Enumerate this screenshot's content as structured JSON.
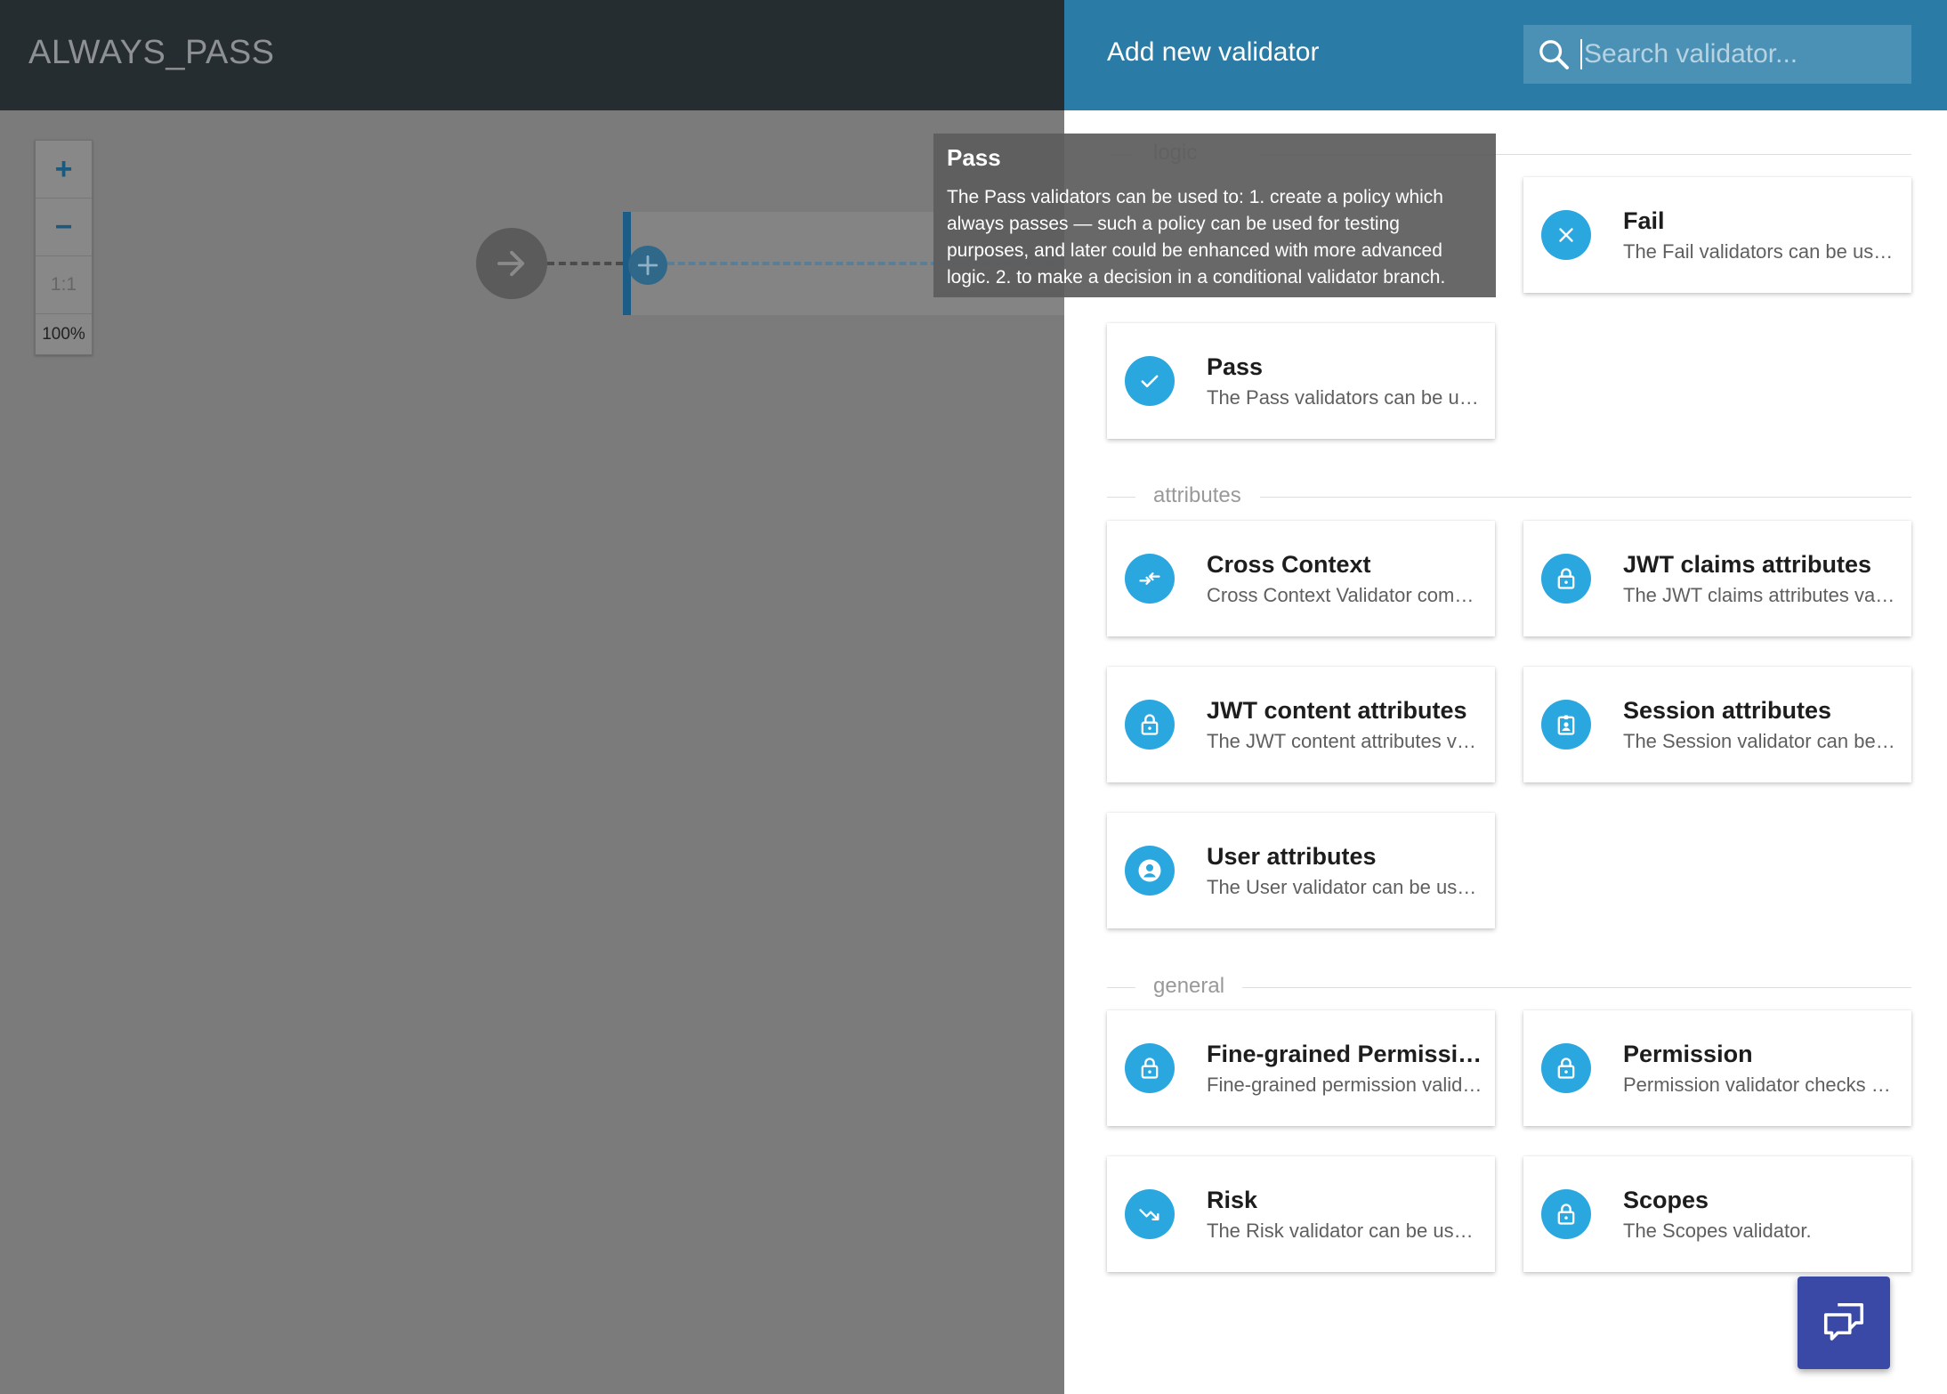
{
  "editor": {
    "title": "ALWAYS_PASS",
    "zoom": {
      "in_label": "+",
      "out_label": "−",
      "reset_label": "1:1",
      "level": "100%"
    }
  },
  "panel": {
    "title": "Add new validator",
    "search": {
      "placeholder": "Search validator...",
      "value": ""
    },
    "sections": {
      "logic": "logic",
      "attributes": "attributes",
      "general": "general"
    },
    "cards": {
      "fail": {
        "title": "Fail",
        "desc": "The Fail validators can be used to make a decision in a conditional validator branch.",
        "icon": "close-icon"
      },
      "pass": {
        "title": "Pass",
        "desc": "The Pass validators can be used to create a policy which always passes.",
        "icon": "check-icon"
      },
      "cross_context": {
        "title": "Cross Context",
        "desc": "Cross Context Validator compares values from different contexts.",
        "icon": "compare-arrows-icon"
      },
      "jwt_claims": {
        "title": "JWT claims attributes",
        "desc": "The JWT claims attributes validator can be used to check claims.",
        "icon": "lock-icon"
      },
      "jwt_content": {
        "title": "JWT content attributes",
        "desc": "The JWT content attributes validator can be used to check content.",
        "icon": "lock-icon"
      },
      "session": {
        "title": "Session attributes",
        "desc": "The Session validator can be used to check session attributes.",
        "icon": "badge-icon"
      },
      "user": {
        "title": "User attributes",
        "desc": "The User validator can be used to check user attributes.",
        "icon": "user-circle-icon"
      },
      "fine_grained": {
        "title": "Fine-grained Permission",
        "desc": "Fine-grained permission validator checks permissions.",
        "icon": "lock-icon"
      },
      "permission": {
        "title": "Permission",
        "desc": "Permission validator checks permissions.",
        "icon": "lock-icon"
      },
      "risk": {
        "title": "Risk",
        "desc": "The Risk validator can be used to evaluate risk.",
        "icon": "trending-down-icon"
      },
      "scopes": {
        "title": "Scopes",
        "desc": "The Scopes validator.",
        "icon": "lock-icon"
      }
    }
  },
  "tooltip": {
    "title": "Pass",
    "body": "The Pass validators can be used to: 1. create a policy which always passes — such a policy can be used for testing purposes, and later could be enhanced with more advanced logic. 2. to make a decision in a conditional validator branch."
  },
  "colors": {
    "panel_header": "#2a7ba5",
    "card_icon": "#2ba7e0",
    "editor_header": "#262d31",
    "chat_button": "#3a49a6"
  }
}
